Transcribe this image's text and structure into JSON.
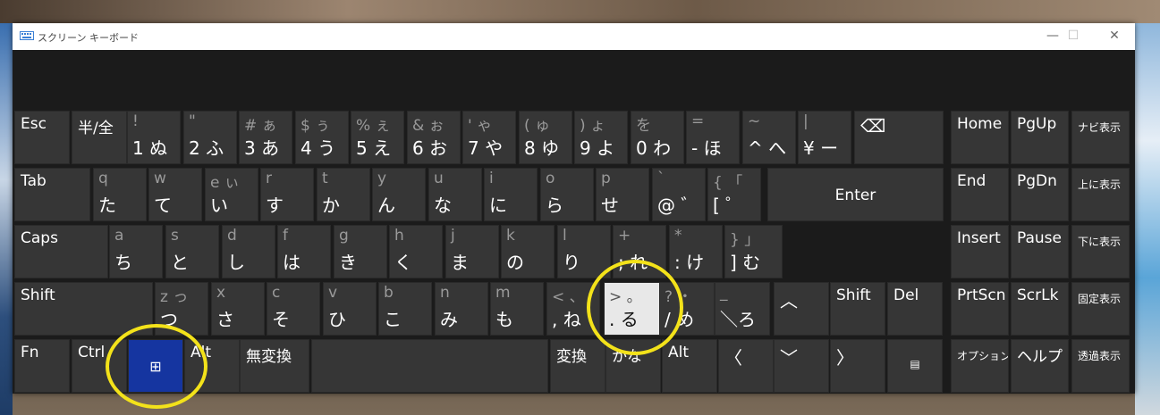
{
  "window": {
    "title": "スクリーン キーボード",
    "minimize": "—",
    "maximize": "☐",
    "close": "✕"
  },
  "row1": [
    {
      "name": "key-esc",
      "label": "Esc"
    },
    {
      "name": "key-hankaku",
      "label": "半/全"
    },
    {
      "name": "key-1",
      "sub": "!",
      "main": "1 ぬ"
    },
    {
      "name": "key-2",
      "sub": "\"",
      "main": "2 ふ"
    },
    {
      "name": "key-3",
      "sub": "# ぁ",
      "main": "3 あ"
    },
    {
      "name": "key-4",
      "sub": "$ ぅ",
      "main": "4 う"
    },
    {
      "name": "key-5",
      "sub": "% ぇ",
      "main": "5 え"
    },
    {
      "name": "key-6",
      "sub": "& ぉ",
      "main": "6 お"
    },
    {
      "name": "key-7",
      "sub": "' ゃ",
      "main": "7 や"
    },
    {
      "name": "key-8",
      "sub": "( ゅ",
      "main": "8 ゆ"
    },
    {
      "name": "key-9",
      "sub": ") ょ",
      "main": "9 よ"
    },
    {
      "name": "key-0",
      "sub": "を",
      "main": "0 わ"
    },
    {
      "name": "key-minus",
      "sub": "=",
      "main": "- ほ"
    },
    {
      "name": "key-caret",
      "sub": "~",
      "main": "^ へ"
    },
    {
      "name": "key-yen",
      "sub": "|",
      "main": "¥ ー"
    },
    {
      "name": "key-backspace",
      "label": "⌫"
    },
    {
      "name": "key-home",
      "label": "Home"
    },
    {
      "name": "key-pgup",
      "label": "PgUp"
    },
    {
      "name": "key-navi",
      "label": "ナビ表示"
    }
  ],
  "row2": [
    {
      "name": "key-tab",
      "label": "Tab"
    },
    {
      "name": "key-q",
      "sub": "q",
      "main": "た"
    },
    {
      "name": "key-w",
      "sub": "w",
      "main": "て"
    },
    {
      "name": "key-e",
      "sub": "e ぃ",
      "main": "い"
    },
    {
      "name": "key-r",
      "sub": "r",
      "main": "す"
    },
    {
      "name": "key-t",
      "sub": "t",
      "main": "か"
    },
    {
      "name": "key-y",
      "sub": "y",
      "main": "ん"
    },
    {
      "name": "key-u",
      "sub": "u",
      "main": "な"
    },
    {
      "name": "key-i",
      "sub": "i",
      "main": "に"
    },
    {
      "name": "key-o",
      "sub": "o",
      "main": "ら"
    },
    {
      "name": "key-p",
      "sub": "p",
      "main": "せ"
    },
    {
      "name": "key-at",
      "sub": "`",
      "main": "@ ゛"
    },
    {
      "name": "key-bracket-open",
      "sub": "{ 「",
      "main": "[ ゜"
    },
    {
      "name": "key-enter",
      "label": "Enter"
    },
    {
      "name": "key-end",
      "label": "End"
    },
    {
      "name": "key-pgdn",
      "label": "PgDn"
    },
    {
      "name": "key-up-display",
      "label": "上に表示"
    }
  ],
  "row3": [
    {
      "name": "key-caps",
      "label": "Caps"
    },
    {
      "name": "key-a",
      "sub": "a",
      "main": "ち"
    },
    {
      "name": "key-s",
      "sub": "s",
      "main": "と"
    },
    {
      "name": "key-d",
      "sub": "d",
      "main": "し"
    },
    {
      "name": "key-f",
      "sub": "f",
      "main": "は"
    },
    {
      "name": "key-g",
      "sub": "g",
      "main": "き"
    },
    {
      "name": "key-h",
      "sub": "h",
      "main": "く"
    },
    {
      "name": "key-j",
      "sub": "j",
      "main": "ま"
    },
    {
      "name": "key-k",
      "sub": "k",
      "main": "の"
    },
    {
      "name": "key-l",
      "sub": "l",
      "main": "り"
    },
    {
      "name": "key-semicolon",
      "sub": "+",
      "main": "; れ"
    },
    {
      "name": "key-colon",
      "sub": "*",
      "main": ": け"
    },
    {
      "name": "key-bracket-close",
      "sub": "} 」",
      "main": "] む"
    },
    {
      "name": "key-insert",
      "label": "Insert"
    },
    {
      "name": "key-pause",
      "label": "Pause"
    },
    {
      "name": "key-down-display",
      "label": "下に表示"
    }
  ],
  "row4": [
    {
      "name": "key-shift-left",
      "label": "Shift"
    },
    {
      "name": "key-z",
      "sub": "z っ",
      "main": "つ"
    },
    {
      "name": "key-x",
      "sub": "x",
      "main": "さ"
    },
    {
      "name": "key-c",
      "sub": "c",
      "main": "そ"
    },
    {
      "name": "key-v",
      "sub": "v",
      "main": "ひ"
    },
    {
      "name": "key-b",
      "sub": "b",
      "main": "こ"
    },
    {
      "name": "key-n",
      "sub": "n",
      "main": "み"
    },
    {
      "name": "key-m",
      "sub": "m",
      "main": "も"
    },
    {
      "name": "key-comma",
      "sub": "< 、",
      "main": ", ね"
    },
    {
      "name": "key-period",
      "sub": "> 。",
      "main": ". る"
    },
    {
      "name": "key-slash",
      "sub": "? ・",
      "main": "/ め"
    },
    {
      "name": "key-backslash",
      "sub": "_",
      "main": "＼ろ"
    },
    {
      "name": "key-arrow-up",
      "label": "︿"
    },
    {
      "name": "key-shift-right",
      "label": "Shift"
    },
    {
      "name": "key-del",
      "label": "Del"
    },
    {
      "name": "key-prtscn",
      "label": "PrtScn"
    },
    {
      "name": "key-scrlk",
      "label": "ScrLk"
    },
    {
      "name": "key-fixed-display",
      "label": "固定表示"
    }
  ],
  "row5": [
    {
      "name": "key-fn",
      "label": "Fn"
    },
    {
      "name": "key-ctrl",
      "label": "Ctrl"
    },
    {
      "name": "key-windows",
      "label": "⊞"
    },
    {
      "name": "key-alt-left",
      "label": "Alt"
    },
    {
      "name": "key-muhenkan",
      "label": "無変換"
    },
    {
      "name": "key-space",
      "label": ""
    },
    {
      "name": "key-henkan",
      "label": "変換"
    },
    {
      "name": "key-kana",
      "label": "かな"
    },
    {
      "name": "key-alt-right",
      "label": "Alt"
    },
    {
      "name": "key-arrow-left",
      "label": "〈"
    },
    {
      "name": "key-arrow-down",
      "label": "﹀"
    },
    {
      "name": "key-arrow-right",
      "label": "〉"
    },
    {
      "name": "key-menu",
      "label": "▤"
    },
    {
      "name": "key-options",
      "label": "オプション"
    },
    {
      "name": "key-help",
      "label": "ヘルプ"
    },
    {
      "name": "key-fade",
      "label": "透過表示"
    }
  ],
  "colors": {
    "key": "#363636",
    "windows_key": "#1535a0",
    "pressed_key": "#e8e8e8",
    "highlight_circle": "#f3e21a"
  }
}
